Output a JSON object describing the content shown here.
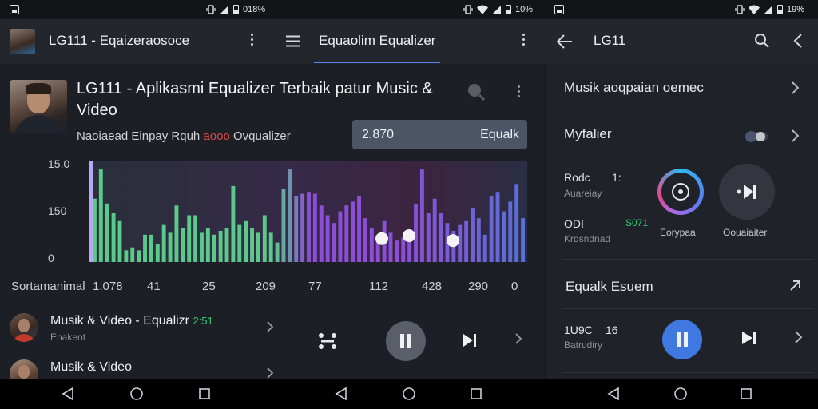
{
  "status_bar": {
    "screens": [
      {
        "battery_text": "018%"
      },
      {
        "battery_text": "10%"
      },
      {
        "battery_text": "19%"
      }
    ],
    "wifi_glyph": "wifi-icon",
    "signal_glyph": "signal-icon"
  },
  "left_header": {
    "title": "LG111 - Eqaizeraosoce"
  },
  "center_header": {
    "title": "Equaolim Equalizer",
    "accent": "#5a88e8"
  },
  "right_header": {
    "title": "LG11"
  },
  "main": {
    "title": "LG111 - Aplikasmi Equalizer Terbaik patur Music & Video",
    "subtitle_prefix": "Naoiaead Einpay Rquh",
    "subtitle_highlight": "aooo",
    "subtitle_suffix": "Ovqualizer",
    "value_box": {
      "value": "2.870",
      "label": "Equalk"
    }
  },
  "chart_data": {
    "type": "bar",
    "y_tick_labels": [
      "15.0",
      "150",
      "0"
    ],
    "x_axis_label": "Sortamanimal",
    "x_tick_labels": [
      "1.078",
      "41",
      "25",
      "209",
      "77",
      "112",
      "428",
      "290",
      "0"
    ],
    "values": [
      0.65,
      0.95,
      0.6,
      0.5,
      0.42,
      0.12,
      0.15,
      0.12,
      0.28,
      0.28,
      0.18,
      0.38,
      0.3,
      0.58,
      0.35,
      0.48,
      0.48,
      0.3,
      0.35,
      0.28,
      0.32,
      0.35,
      0.78,
      0.38,
      0.42,
      0.35,
      0.3,
      0.48,
      0.3,
      0.2,
      0.75,
      0.95,
      0.68,
      0.7,
      0.72,
      0.7,
      0.58,
      0.48,
      0.4,
      0.52,
      0.58,
      0.62,
      0.68,
      0.45,
      0.35,
      0.25,
      0.42,
      0.3,
      0.22,
      0.25,
      0.3,
      0.6,
      0.95,
      0.5,
      0.65,
      0.5,
      0.4,
      0.32,
      0.38,
      0.42,
      0.55,
      0.45,
      0.28,
      0.68,
      0.72,
      0.52,
      0.62,
      0.8,
      0.45
    ],
    "handles": [
      0.24,
      0.27,
      0.22
    ],
    "gradient": [
      "#5ac98a",
      "#8a4fd6",
      "#5a6fd8"
    ]
  },
  "list": [
    {
      "title": "Musik & Video - Equalizr",
      "badge": "2:51",
      "subtitle": "Enakent"
    },
    {
      "title": "Musik & Video",
      "badge": "",
      "subtitle": ""
    }
  ],
  "right_panel": {
    "row1": "Musik aoqpaian oemec",
    "row2": "Myfalier",
    "row3_title": "Rodc",
    "row3_value": "1:",
    "row3_sub": "Auareiay",
    "row4_title": "ODI",
    "row4_value": "S071",
    "row4_sub": "Krdsndnad",
    "ring_label": "Eorypaa",
    "play_label": "Oouaiaiter",
    "row5": "Equalk Esuem",
    "row6_title": "1U9C",
    "row6_value": "16",
    "row6_sub": "Batrudiry",
    "colors": {
      "toggle": "#4a5570",
      "play_blue": "#3f78e0"
    }
  }
}
